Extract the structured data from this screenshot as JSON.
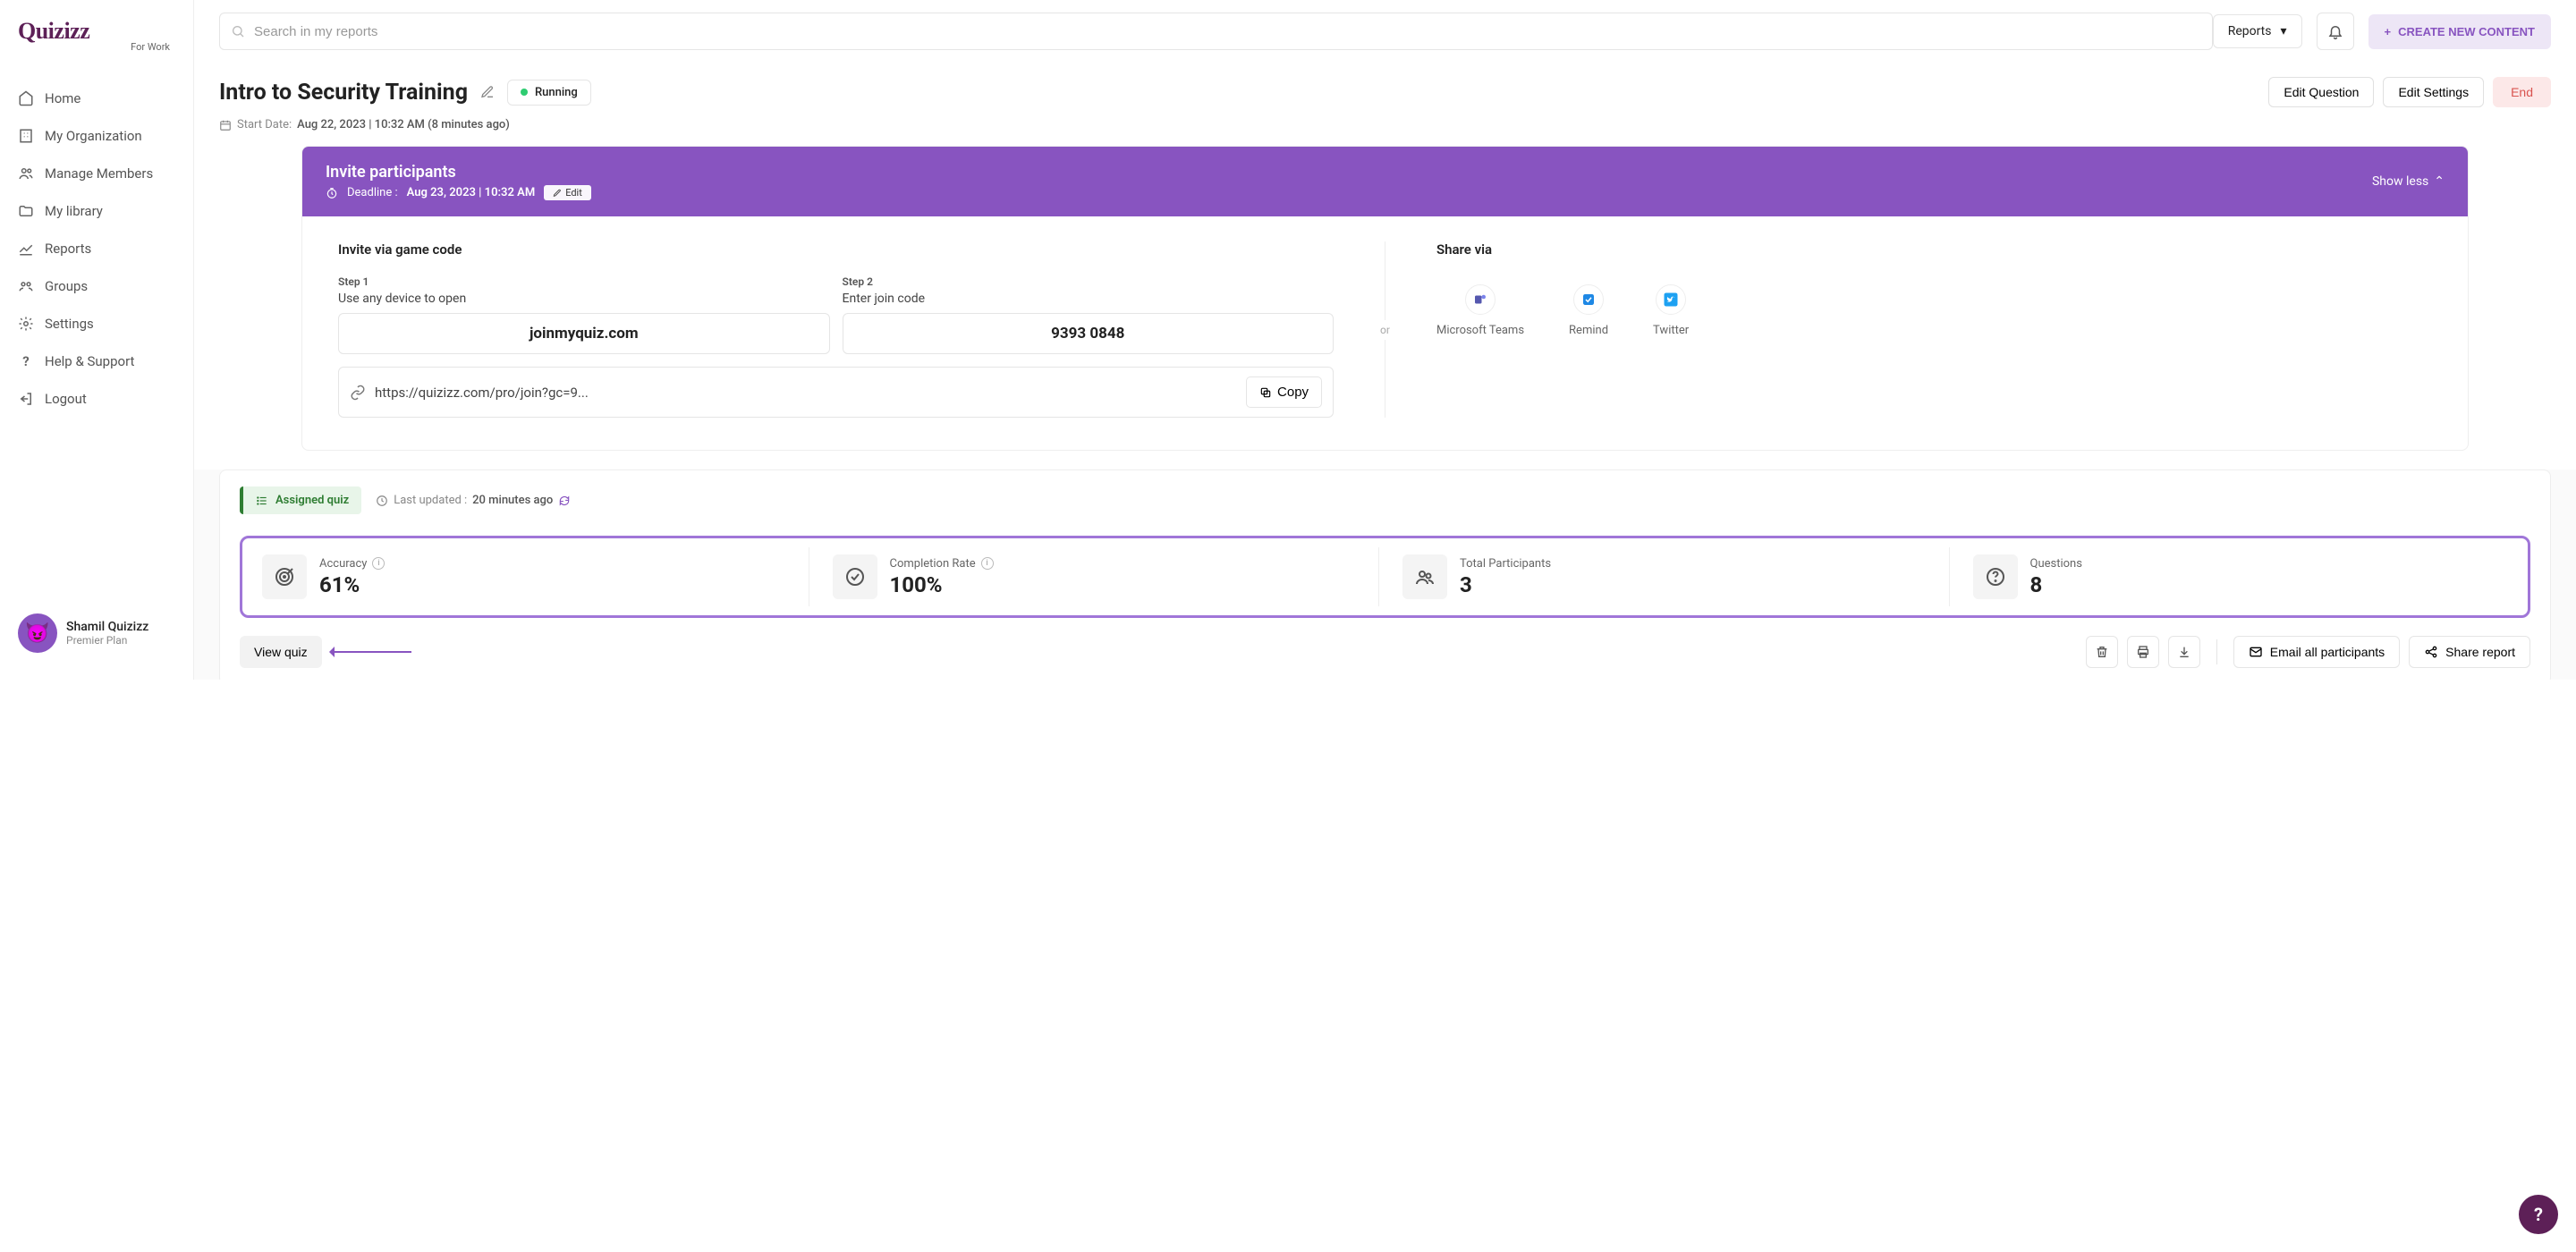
{
  "brand": {
    "name": "Quizizz",
    "sub": "For Work"
  },
  "sidebar": {
    "items": [
      {
        "label": "Home"
      },
      {
        "label": "My Organization"
      },
      {
        "label": "Manage Members"
      },
      {
        "label": "My library"
      },
      {
        "label": "Reports"
      },
      {
        "label": "Groups"
      },
      {
        "label": "Settings"
      },
      {
        "label": "Help & Support"
      },
      {
        "label": "Logout"
      }
    ]
  },
  "user": {
    "name": "Shamil Quizizz",
    "plan": "Premier Plan"
  },
  "topbar": {
    "search_placeholder": "Search in my reports",
    "dropdown": "Reports",
    "create": "CREATE NEW CONTENT"
  },
  "page": {
    "title": "Intro to Security Training",
    "status": "Running",
    "edit_question": "Edit Question",
    "edit_settings": "Edit Settings",
    "end": "End",
    "start_date_label": "Start Date:",
    "start_date": "Aug 22, 2023 | 10:32 AM (8 minutes ago)"
  },
  "invite": {
    "title": "Invite participants",
    "deadline_label": "Deadline  :",
    "deadline": "Aug 23, 2023 | 10:32 AM",
    "deadline_edit": "Edit",
    "show_less": "Show less",
    "gamecode_title": "Invite via game code",
    "step1": "Step 1",
    "step1_desc": "Use any device to open",
    "step1_box": "joinmyquiz.com",
    "step2": "Step 2",
    "step2_desc": "Enter join code",
    "step2_box": "9393 0848",
    "link": "https://quizizz.com/pro/join?gc=9...",
    "copy": "Copy",
    "or": "or",
    "share_title": "Share via",
    "share": [
      {
        "label": "Microsoft Teams"
      },
      {
        "label": "Remind"
      },
      {
        "label": "Twitter"
      }
    ]
  },
  "report": {
    "assigned": "Assigned quiz",
    "updated_label": "Last updated :",
    "updated": "20 minutes ago",
    "stats": [
      {
        "label": "Accuracy",
        "value": "61%",
        "info": true
      },
      {
        "label": "Completion Rate",
        "value": "100%",
        "info": true
      },
      {
        "label": "Total Participants",
        "value": "3",
        "info": false
      },
      {
        "label": "Questions",
        "value": "8",
        "info": false
      }
    ],
    "view_quiz": "View quiz",
    "email_all": "Email all participants",
    "share_report": "Share report"
  },
  "help_fab": "?"
}
